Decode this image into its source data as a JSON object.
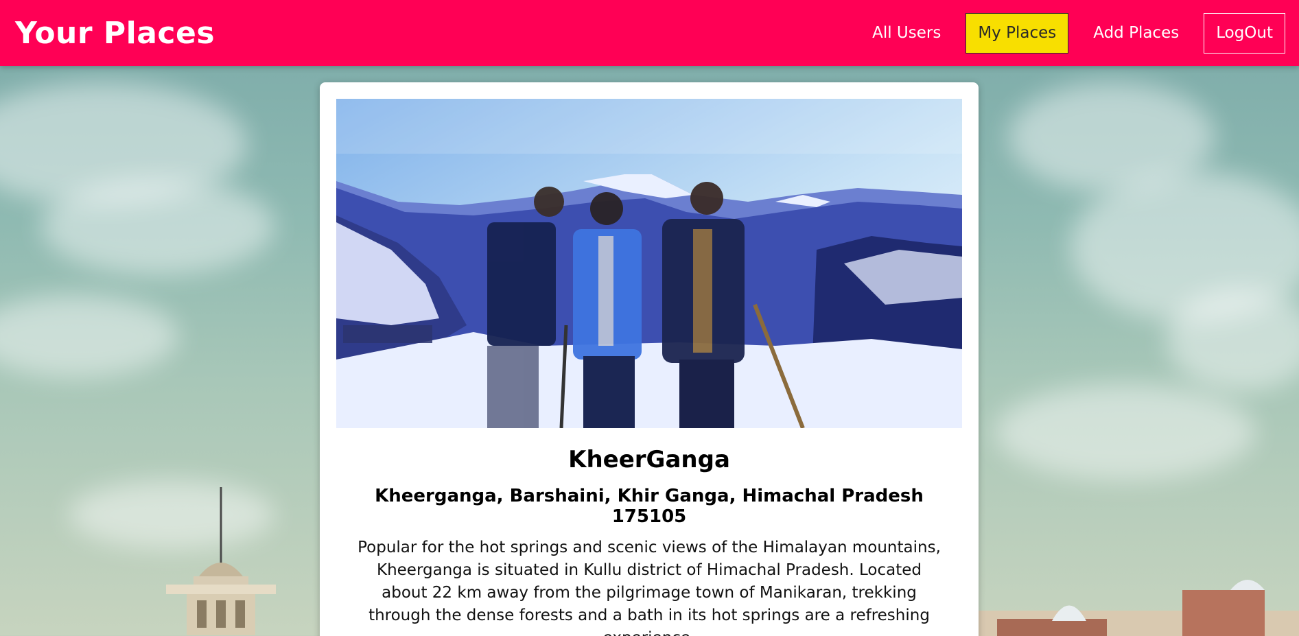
{
  "header": {
    "brand": "Your Places",
    "nav": [
      {
        "label": "All Users",
        "state": "normal"
      },
      {
        "label": "My Places",
        "state": "active"
      },
      {
        "label": "Add Places",
        "state": "normal"
      },
      {
        "label": "LogOut",
        "state": "outlined"
      }
    ]
  },
  "place": {
    "title": "KheerGanga",
    "address": "Kheerganga, Barshaini, Khir Ganga, Himachal Pradesh 175105",
    "description": "Popular for the hot springs and scenic views of the Himalayan mountains, Kheerganga is situated in Kullu district of Himachal Pradesh. Located about 22 km away from the pilgrimage town of Manikaran, trekking through the dense forests and a bath in its hot springs are a refreshing experience."
  },
  "colors": {
    "header_bg": "#ff0055",
    "active_nav_bg": "#f8df00",
    "card_bg": "#ffffff"
  }
}
